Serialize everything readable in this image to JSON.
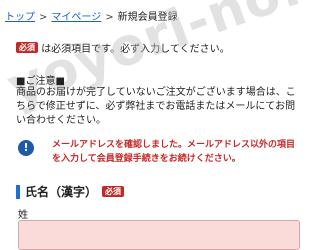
{
  "breadcrumb": {
    "home": "トップ",
    "mypage": "マイページ",
    "current": "新規会員登録",
    "separator": ">"
  },
  "required_note": {
    "badge": "必須",
    "text": "は必須項目です。必ず入力してください。"
  },
  "watermark": "yoyori-no.com",
  "notice": {
    "title": "■ご注意■",
    "body": "商品のお届けが完了していないご注文がございます場合は、こちらで修正せずに、必ず弊社までお電話またはメールにてお問い合わせください。"
  },
  "alert": {
    "icon": "!",
    "text": "メールアドレスを確認しました。メールアドレス以外の項目を入力して会員登録手続きをお続けください。"
  },
  "name_section": {
    "heading": "氏名（漢字）",
    "badge": "必須",
    "last_name_label": "姓",
    "last_name_value": ""
  },
  "colors": {
    "required_red": "#c62828",
    "link_blue": "#1a5fd6",
    "accent_blue": "#1a73c8",
    "input_error_bg": "#fbdada"
  }
}
